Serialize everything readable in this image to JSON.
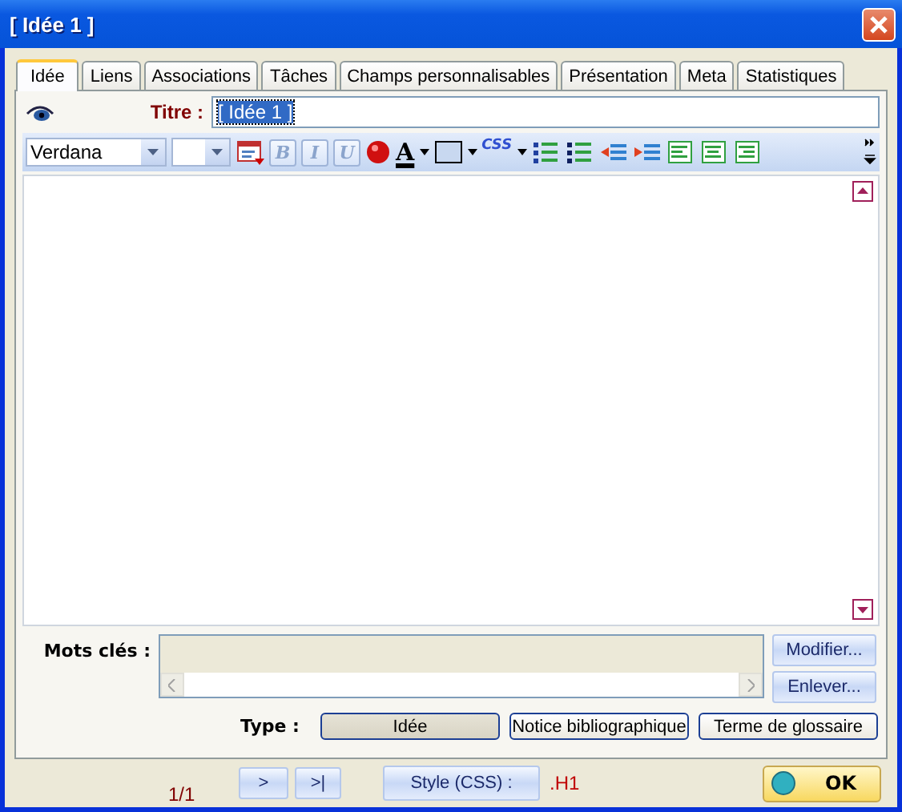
{
  "window": {
    "title": "[ Idée 1 ]"
  },
  "tabs": [
    {
      "label": "Idée",
      "selected": true
    },
    {
      "label": "Liens",
      "selected": false
    },
    {
      "label": "Associations",
      "selected": false
    },
    {
      "label": "Tâches",
      "selected": false
    },
    {
      "label": "Champs personnalisables",
      "selected": false
    },
    {
      "label": "Présentation",
      "selected": false
    },
    {
      "label": "Meta",
      "selected": false
    },
    {
      "label": "Statistiques",
      "selected": false
    }
  ],
  "title_field": {
    "label": "Titre :",
    "value": "[ Idée 1 ]"
  },
  "toolbar": {
    "font": "Verdana",
    "format_buttons": [
      "B",
      "I",
      "U"
    ],
    "color_letter": "A",
    "css_label": "CSS"
  },
  "keywords": {
    "label": "Mots clés :",
    "buttons": [
      "Modifier...",
      "Enlever..."
    ]
  },
  "type": {
    "label": "Type :",
    "options": [
      {
        "label": "Idée",
        "selected": true
      },
      {
        "label": "Notice bibliographique",
        "selected": false
      },
      {
        "label": "Terme de glossaire",
        "selected": false
      }
    ]
  },
  "footer": {
    "page": "1/1",
    "nav": [
      ">",
      ">|"
    ],
    "style_button": "Style (CSS) :",
    "style_value": ".H1",
    "ok": "OK"
  }
}
